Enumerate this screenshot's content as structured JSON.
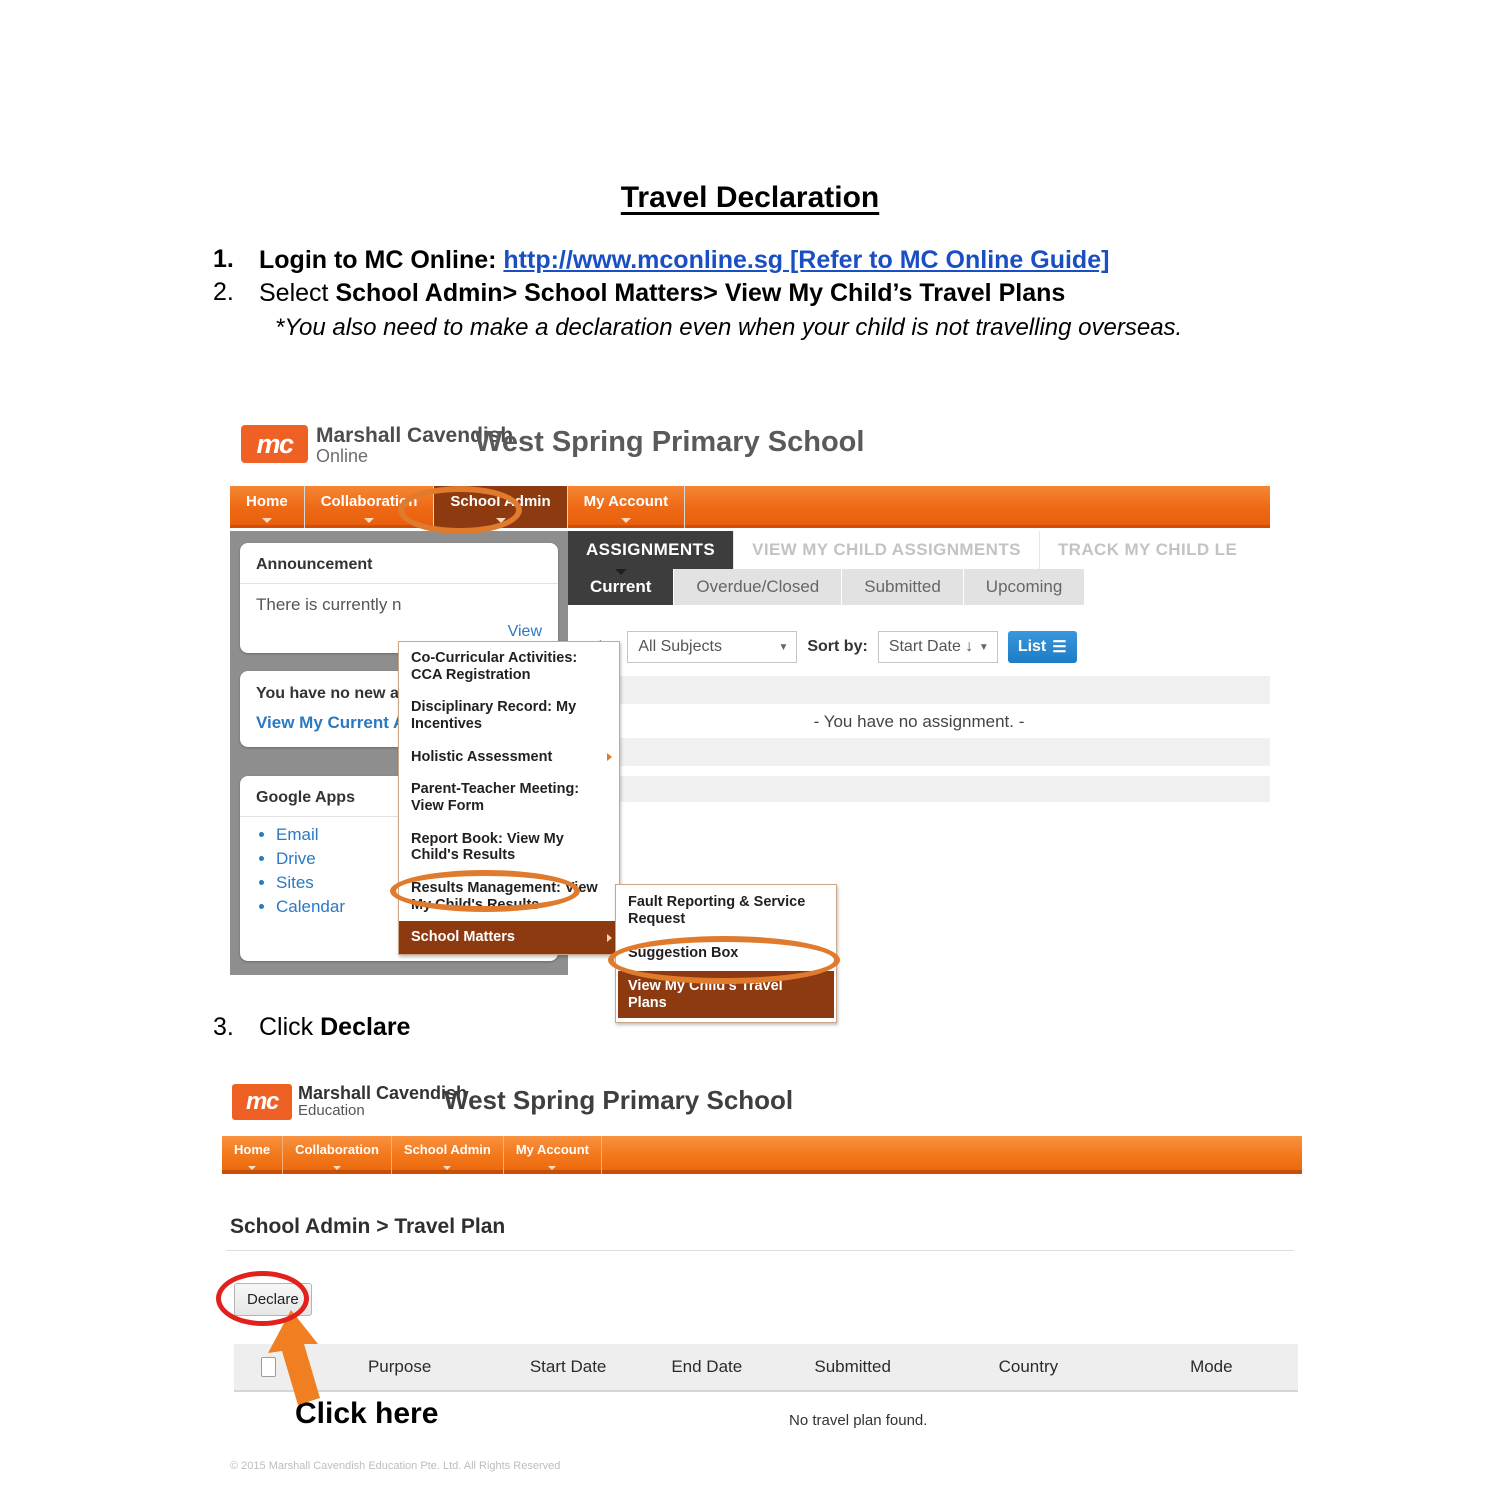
{
  "document": {
    "title": "Travel Declaration",
    "steps": [
      {
        "num": "1.",
        "label": "Login to MC Online:",
        "link": "http://www.mconline.sg [Refer to MC Online Guide]"
      },
      {
        "num": "2.",
        "prefix": "Select ",
        "bold": "School Admin> School Matters> View My Child’s Travel Plans",
        "note": "*You also need to make a declaration even when your child is not travelling overseas."
      },
      {
        "num": "3.",
        "prefix": "Click ",
        "bold": "Declare"
      }
    ]
  },
  "shot1": {
    "brand": {
      "line1": "Marshall Cavendish",
      "line2": "Online",
      "logo_text": "mc"
    },
    "school_name": "West Spring Primary School",
    "nav": [
      {
        "label": "Home",
        "active": false
      },
      {
        "label": "Collaboration",
        "active": false
      },
      {
        "label": "School Admin",
        "active": true
      },
      {
        "label": "My Account",
        "active": false
      }
    ],
    "dropdown": [
      {
        "label": "Co-Curricular Activities: CCA Registration",
        "highlighted": false,
        "submenu": false
      },
      {
        "label": "Disciplinary Record: My Incentives",
        "highlighted": false,
        "submenu": false
      },
      {
        "label": "Holistic Assessment",
        "highlighted": false,
        "submenu": true
      },
      {
        "label": "Parent-Teacher Meeting: View Form",
        "highlighted": false,
        "submenu": false
      },
      {
        "label": "Report Book: View My Child's Results",
        "highlighted": false,
        "submenu": false
      },
      {
        "label": "Results Management: View My Child's Results",
        "highlighted": false,
        "submenu": false
      },
      {
        "label": "School Matters",
        "highlighted": true,
        "submenu": true
      }
    ],
    "submenu": [
      {
        "label": "Fault Reporting & Service Request",
        "highlighted": false
      },
      {
        "label": "Suggestion Box",
        "highlighted": false
      },
      {
        "label": "View My Child's Travel Plans",
        "highlighted": true
      }
    ],
    "panels": {
      "announcement": {
        "title": "Announcement",
        "text": "There is currently n",
        "link": "View"
      },
      "assignments": {
        "title": "You have no new ass",
        "link": "View My Current As"
      },
      "google_apps": {
        "title": "Google Apps",
        "items": [
          "Email",
          "Drive",
          "Sites",
          "Calendar"
        ]
      }
    },
    "big_tabs": [
      {
        "label": "ASSIGNMENTS",
        "active": true
      },
      {
        "label": "VIEW MY CHILD ASSIGNMENTS",
        "active": false
      },
      {
        "label": "TRACK MY CHILD LE",
        "active": false
      }
    ],
    "sub_tabs": [
      {
        "label": "Current",
        "active": true
      },
      {
        "label": "Overdue/Closed",
        "active": false
      },
      {
        "label": "Submitted",
        "active": false
      },
      {
        "label": "Upcoming",
        "active": false
      }
    ],
    "filters": {
      "subject_label": "ects:",
      "subject_value": "All Subjects",
      "sort_label": "Sort by:",
      "sort_value": "Start Date ↓",
      "list_button": "List"
    },
    "empty_message": "- You have no assignment. -"
  },
  "shot2": {
    "brand": {
      "line1": "Marshall Cavendish",
      "line2": "Education",
      "logo_text": "mc"
    },
    "school_name": "West Spring Primary School",
    "nav": [
      {
        "label": "Home"
      },
      {
        "label": "Collaboration"
      },
      {
        "label": "School Admin"
      },
      {
        "label": "My Account"
      }
    ],
    "breadcrumb": "School Admin > Travel Plan",
    "declare_button": "Declare",
    "table": {
      "columns": [
        "Purpose",
        "Start Date",
        "End Date",
        "Submitted",
        "Country",
        "Mode"
      ],
      "empty_message": "No travel plan found.",
      "rows": []
    },
    "footer": "© 2015 Marshall Cavendish Education Pte. Ltd. All Rights Reserved"
  },
  "annotations": {
    "click_here": "Click here",
    "highlight_color": "#e07b2d",
    "red_circle_color": "#e2211c",
    "arrow_color": "#ef7f20"
  }
}
